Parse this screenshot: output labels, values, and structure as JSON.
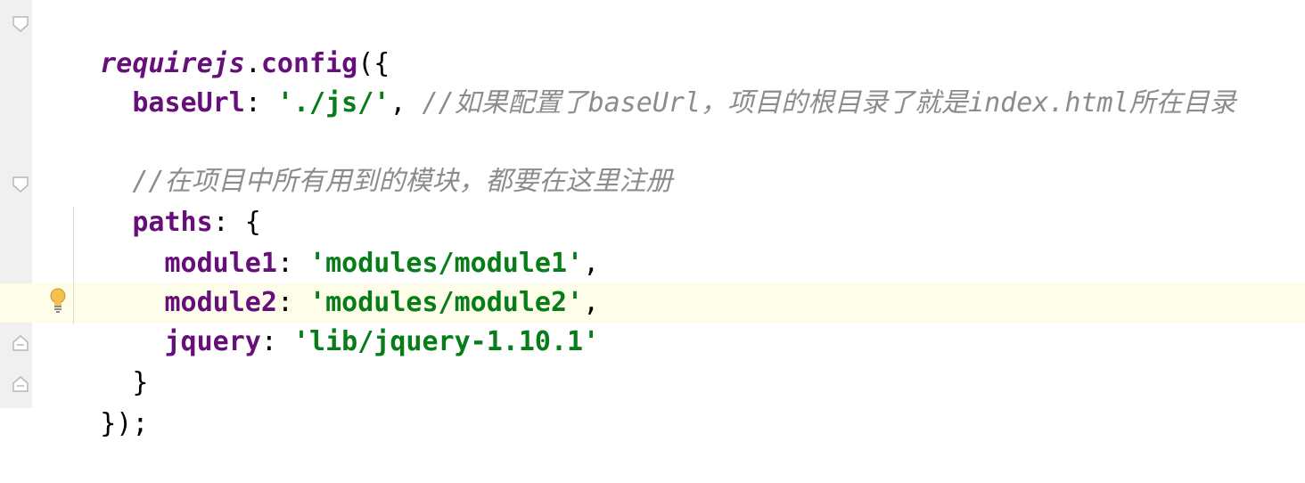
{
  "editor": {
    "lines": [
      {
        "fn": "requirejs",
        "dot": ".",
        "method": "config",
        "tail": "({"
      },
      {
        "indent": "  ",
        "key": "baseUrl",
        "colon": ": ",
        "str": "'./js/'",
        "sep": ", ",
        "comment": "//如果配置了baseUrl，项目的根目录了就是index.html所在目录"
      },
      {
        "text": ""
      },
      {
        "indent": "  ",
        "comment": "//在项目中所有用到的模块，都要在这里注册"
      },
      {
        "indent": "  ",
        "key": "paths",
        "tail": ": {"
      },
      {
        "indent": "    ",
        "key": "module1",
        "colon": ": ",
        "str": "'modules/module1'",
        "sep": ","
      },
      {
        "indent": "    ",
        "key": "module2",
        "colon": ": ",
        "str": "'modules/module2'",
        "sep": ","
      },
      {
        "indent": "    ",
        "key": "jquery",
        "colon": ": ",
        "str": "'lib/jquery-1.10.1'"
      },
      {
        "indent": "  ",
        "tail": "}"
      },
      {
        "tail": "});"
      }
    ]
  },
  "colors": {
    "keyword": "#660e7a",
    "string": "#067d17",
    "comment": "#8c8c8c",
    "highlight_line": "#fefde9",
    "gutter": "#f0f0f0"
  },
  "icons": [
    "fold-open-icon",
    "fold-close-icon",
    "lightbulb-icon"
  ]
}
